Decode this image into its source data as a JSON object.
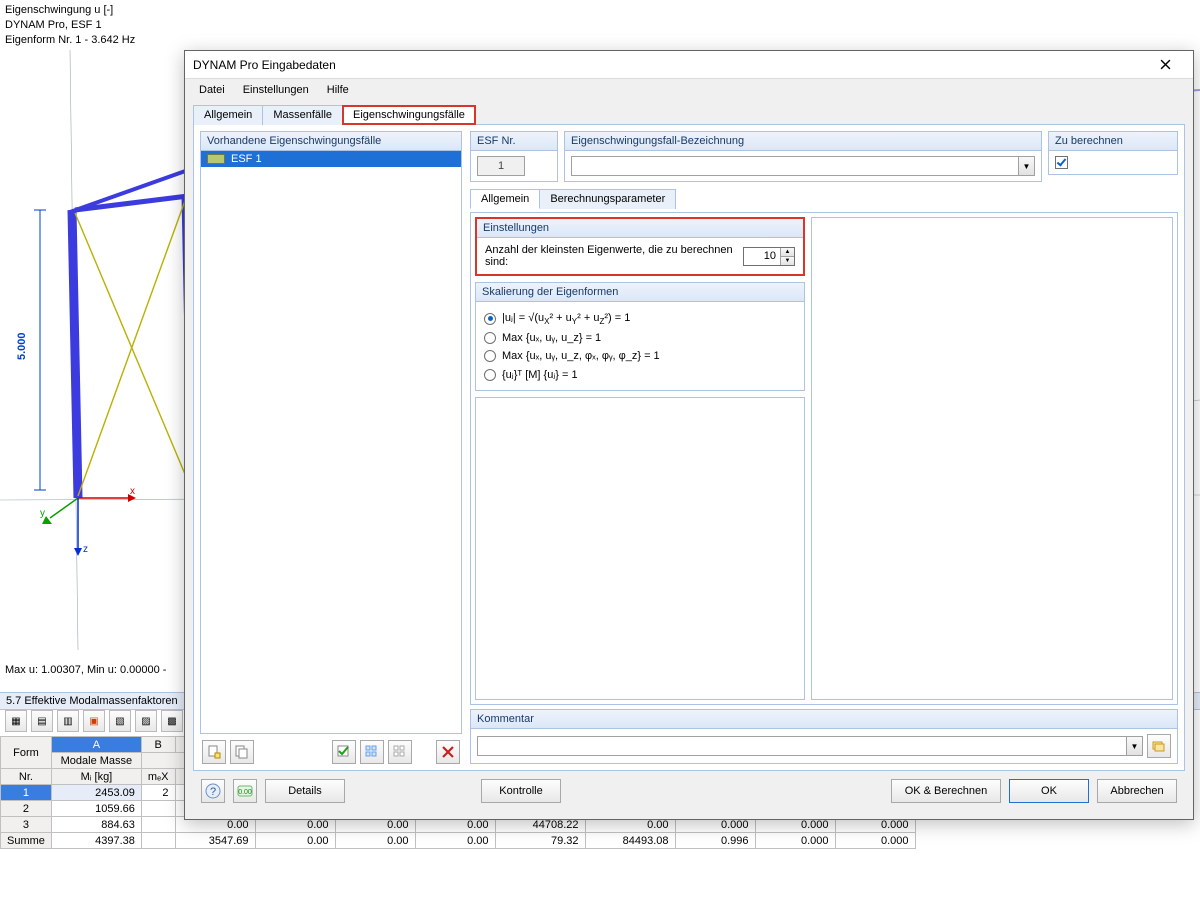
{
  "bg": {
    "overlay": {
      "l1": "Eigenschwingung u [-]",
      "l2": "DYNAM Pro, ESF 1",
      "l3": "Eigenform Nr. 1 - 3.642 Hz"
    },
    "dim_label": "5.000",
    "axes": {
      "x": "x",
      "y": "y",
      "z": "z"
    },
    "status": "Max u: 1.00307, Min u: 0.00000 -",
    "results_title": "5.7 Effektive Modalmassenfaktoren",
    "grid": {
      "h_form": "Form",
      "h_nr": "Nr.",
      "h_mm1": "Modale Masse",
      "h_mm2": "Mᵢ [kg]",
      "h_mex": "mₑX",
      "colA": "A",
      "colB": "B",
      "rows": [
        {
          "nr": "1",
          "m": "2453.09",
          "b": "2"
        },
        {
          "nr": "2",
          "m": "1059.66",
          "b": ""
        },
        {
          "nr": "3",
          "m": "884.63",
          "b": ""
        }
      ],
      "sum_label": "Summe",
      "sum": [
        "4397.38",
        "3547.69",
        "0.00",
        "0.00",
        "0.00",
        "79.32",
        "84493.08",
        "0.996",
        "0.000",
        "0.000"
      ],
      "row3_tail": [
        "0.00",
        "0.00",
        "0.00",
        "0.00",
        "44708.22",
        "0.00",
        "0.000",
        "0.000",
        "0.000"
      ]
    }
  },
  "dialog": {
    "title": "DYNAM Pro Eingabedaten",
    "menu": {
      "file": "Datei",
      "settings": "Einstellungen",
      "help": "Hilfe"
    },
    "tabs": {
      "t1": "Allgemein",
      "t2": "Massenfälle",
      "t3": "Eigenschwingungsfälle"
    },
    "left_header": "Vorhandene Eigenschwingungsfälle",
    "list_item0": "ESF 1",
    "panels": {
      "esfnr_h": "ESF Nr.",
      "esfnr_v": "1",
      "bez_h": "Eigenschwingungsfall-Bezeichnung",
      "calc_h": "Zu berechnen"
    },
    "subtabs": {
      "s1": "Allgemein",
      "s2": "Berechnungsparameter"
    },
    "einst": {
      "h": "Einstellungen",
      "label": "Anzahl der kleinsten Eigenwerte, die zu berechnen sind:",
      "value": "10"
    },
    "skal": {
      "h": "Skalierung der Eigenformen",
      "r1_a": "|uⱼ| = √(u",
      "r1_b": "² + u",
      "r1_c": "² + u",
      "r1_d": "²) = 1",
      "r2": "Max {uₓ, uᵧ, u_z} = 1",
      "r3": "Max {uₓ, uᵧ, u_z, φₓ, φᵧ, φ_z} = 1",
      "r4": "{uⱼ}ᵀ [M] {uⱼ} = 1",
      "sub_x": "X",
      "sub_y": "Y",
      "sub_z": "Z"
    },
    "comment_h": "Kommentar",
    "buttons": {
      "details": "Details",
      "kontrolle": "Kontrolle",
      "okcalc": "OK & Berechnen",
      "ok": "OK",
      "cancel": "Abbrechen"
    }
  }
}
